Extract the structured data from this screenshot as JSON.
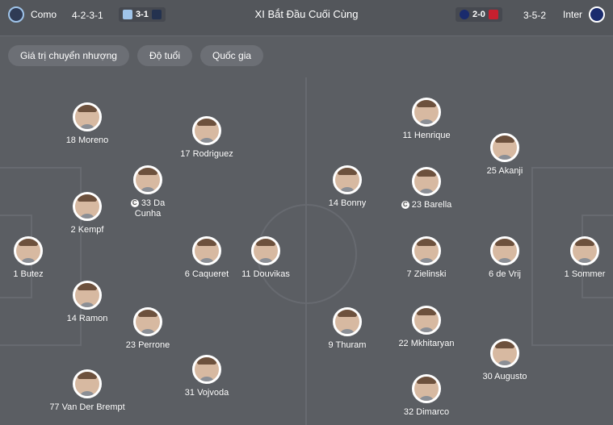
{
  "header": {
    "title": "XI Bắt Đầu Cuối Cùng",
    "home": {
      "name": "Como",
      "formation": "4-2-3-1",
      "last_result": "3-1"
    },
    "away": {
      "name": "Inter",
      "formation": "3-5-2",
      "last_result": "2-0"
    }
  },
  "filters": [
    "Giá trị chuyển nhượng",
    "Độ tuổi",
    "Quốc gia"
  ],
  "players": {
    "home": [
      {
        "num": "18",
        "name": "Moreno"
      },
      {
        "num": "17",
        "name": "Rodriguez"
      },
      {
        "num": "33",
        "name": "Da",
        "name2": "Cunha",
        "captain": "C"
      },
      {
        "num": "2",
        "name": "Kempf"
      },
      {
        "num": "1",
        "name": "Butez"
      },
      {
        "num": "6",
        "name": "Caqueret"
      },
      {
        "num": "11",
        "name": "Douvikas"
      },
      {
        "num": "14",
        "name": "Ramon"
      },
      {
        "num": "23",
        "name": "Perrone"
      },
      {
        "num": "31",
        "name": "Vojvoda"
      },
      {
        "num": "77",
        "name": "Van Der Brempt"
      }
    ],
    "away": [
      {
        "num": "11",
        "name": "Henrique"
      },
      {
        "num": "25",
        "name": "Akanji"
      },
      {
        "num": "14",
        "name": "Bonny"
      },
      {
        "num": "23",
        "name": "Barella",
        "captain": "C"
      },
      {
        "num": "7",
        "name": "Zielinski"
      },
      {
        "num": "6",
        "name": "de Vrij"
      },
      {
        "num": "1",
        "name": "Sommer"
      },
      {
        "num": "9",
        "name": "Thuram"
      },
      {
        "num": "22",
        "name": "Mkhitaryan"
      },
      {
        "num": "30",
        "name": "Augusto"
      },
      {
        "num": "32",
        "name": "Dimarco"
      }
    ]
  },
  "colors": {
    "home_crest": "#9fc4ea",
    "away_crest": "#1a2b6d",
    "opponent_crest_red": "#c8202f"
  }
}
